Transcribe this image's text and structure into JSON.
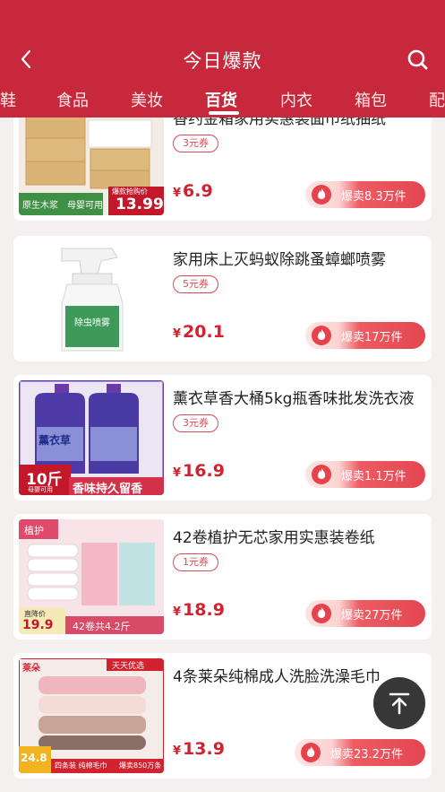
{
  "header": {
    "title": "今日爆款",
    "bg_color": "#c8283b",
    "back_icon": "chevron-left-icon",
    "search_icon": "search-icon"
  },
  "tabs": {
    "items": [
      "鞋",
      "食品",
      "美妆",
      "百货",
      "内衣",
      "箱包",
      "配"
    ],
    "active": "百货"
  },
  "products": [
    {
      "name": "香约金箱家用实惠装面巾纸抽纸",
      "coupon": "3元券",
      "currency": "¥",
      "price": "6.9",
      "hot": "爆卖8.3万件",
      "thumb_labels": {
        "a": "原生木浆",
        "b": "母婴可用",
        "c": "13.99",
        "d": "爆款抢购价"
      }
    },
    {
      "name": "家用床上灭蚂蚁除跳蚤蟑螂喷雾",
      "coupon": "5元券",
      "currency": "¥",
      "price": "20.1",
      "hot": "爆卖17万件",
      "thumb_labels": {
        "a": "除虫喷雾"
      }
    },
    {
      "name": "薰衣草香大桶5kg瓶香味批发洗衣液",
      "coupon": "3元券",
      "currency": "¥",
      "price": "16.9",
      "hot": "爆卖1.1万件",
      "thumb_labels": {
        "a": "10斤",
        "b": "母婴可用",
        "c": "香味持久留香",
        "d": "薰衣草"
      }
    },
    {
      "name": "42卷植护无芯家用实惠装卷纸",
      "coupon": "1元券",
      "currency": "¥",
      "price": "18.9",
      "hot": "爆卖27万件",
      "thumb_labels": {
        "a": "植护",
        "b": "直降价",
        "c": "19.9",
        "d": "42卷共4.2斤"
      }
    },
    {
      "name": "4条莱朵纯棉成人洗脸洗澡毛巾",
      "coupon": "",
      "currency": "¥",
      "price": "13.9",
      "hot": "爆卖23.2万件",
      "thumb_labels": {
        "a": "莱朵",
        "b": "天天优选",
        "c": "24.8",
        "d": "四条装 纯棉毛巾",
        "e": "爆卖850万条"
      }
    }
  ],
  "fab": {
    "icon": "back-to-top-icon"
  }
}
